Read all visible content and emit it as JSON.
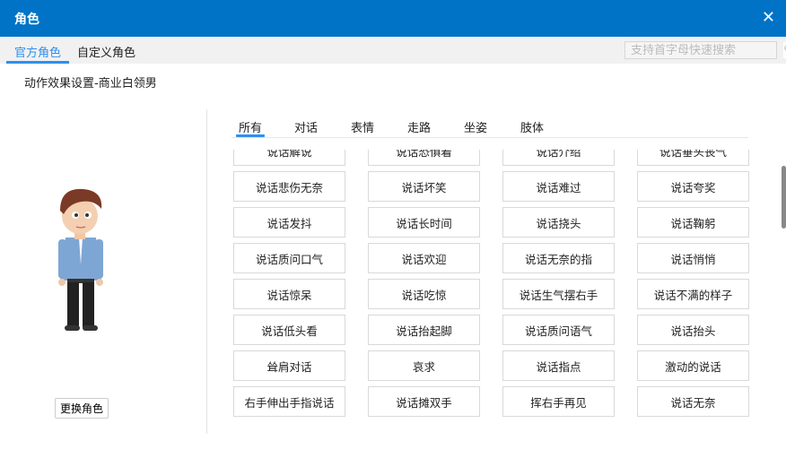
{
  "dialog": {
    "title": "角色",
    "close_icon": "close-icon"
  },
  "tabs": [
    {
      "label": "官方角色",
      "active": true
    },
    {
      "label": "自定义角色",
      "active": false
    }
  ],
  "search": {
    "placeholder": "支持首字母快速搜索",
    "icon": "search-icon"
  },
  "subtitle": "动作效果设置-商业白领男",
  "change_role_label": "更换角色",
  "categories": [
    {
      "label": "所有",
      "active": true
    },
    {
      "label": "对话"
    },
    {
      "label": "表情"
    },
    {
      "label": "走路"
    },
    {
      "label": "坐姿"
    },
    {
      "label": "肢体"
    }
  ],
  "actions": [
    "说话解说",
    "说话恐惧着",
    "说话介绍",
    "说话垂头丧气",
    "说话悲伤无奈",
    "说话坏笑",
    "说话难过",
    "说话夸奖",
    "说话发抖",
    "说话长时间",
    "说话挠头",
    "说话鞠躬",
    "说话质问口气",
    "说话欢迎",
    "说话无奈的指",
    "说话悄悄",
    "说话惊呆",
    "说话吃惊",
    "说话生气摆右手",
    "说话不满的样子",
    "说话低头看",
    "说话抬起脚",
    "说话质问语气",
    "说话抬头",
    "耸肩对话",
    "哀求",
    "说话指点",
    "激动的说话",
    "右手伸出手指说话",
    "说话摊双手",
    "挥右手再见",
    "说话无奈"
  ],
  "colors": {
    "titlebar": "#0173c6",
    "accent": "#2e8ff0"
  }
}
